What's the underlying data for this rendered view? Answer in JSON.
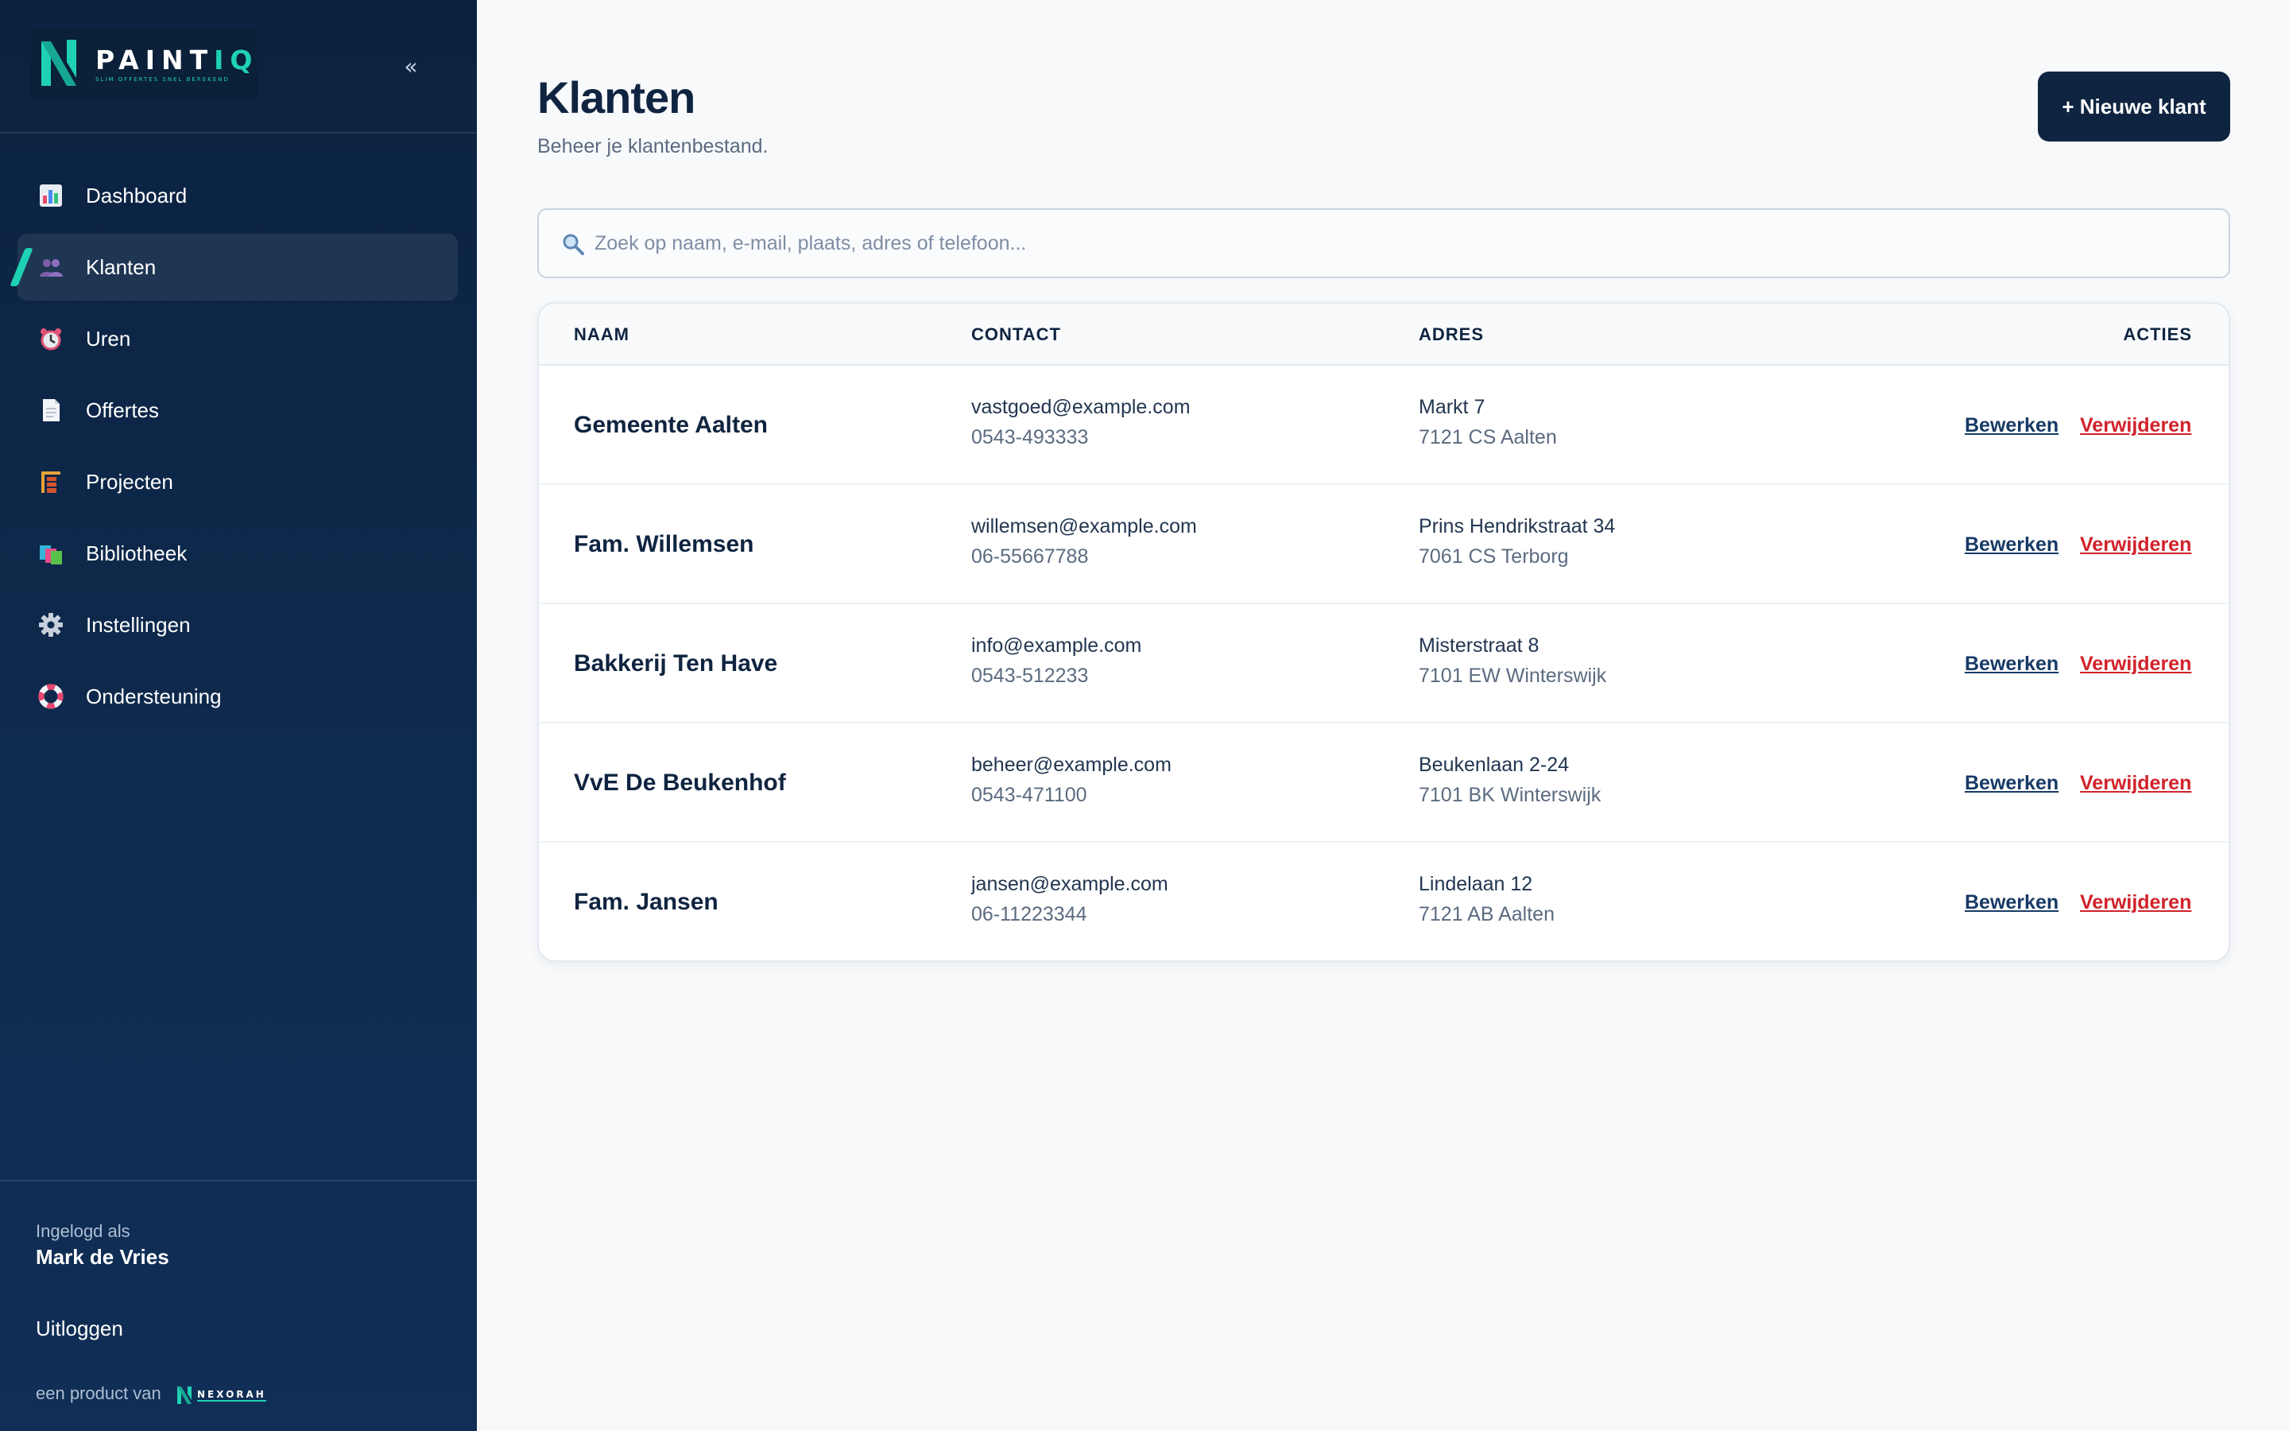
{
  "brand": {
    "name_main": "PAINT",
    "name_accent": "IQ",
    "tagline": "SLIM OFFERTES SNEL BEREKEND",
    "accent_color": "#1fd1b4",
    "sidebar_color": "#0c2240"
  },
  "sidebar": {
    "collapse_icon": "«",
    "items": [
      {
        "label": "Dashboard",
        "icon": "bar-chart-icon"
      },
      {
        "label": "Klanten",
        "icon": "users-icon",
        "active": true
      },
      {
        "label": "Uren",
        "icon": "alarm-clock-icon"
      },
      {
        "label": "Offertes",
        "icon": "document-icon"
      },
      {
        "label": "Projecten",
        "icon": "building-construction-icon"
      },
      {
        "label": "Bibliotheek",
        "icon": "books-icon"
      },
      {
        "label": "Instellingen",
        "icon": "gear-icon"
      },
      {
        "label": "Ondersteuning",
        "icon": "lifebuoy-icon"
      }
    ],
    "logged_in_label": "Ingelogd als",
    "user_name": "Mark de Vries",
    "logout_label": "Uitloggen",
    "product_by": "een product van",
    "company": "NEXORAH"
  },
  "header": {
    "title": "Klanten",
    "subtitle": "Beheer je klantenbestand.",
    "new_button": "+ Nieuwe klant"
  },
  "search": {
    "placeholder": "Zoek op naam, e-mail, plaats, adres of telefoon...",
    "value": ""
  },
  "table": {
    "columns": [
      "NAAM",
      "CONTACT",
      "ADRES",
      "ACTIES"
    ],
    "edit_label": "Bewerken",
    "delete_label": "Verwijderen",
    "rows": [
      {
        "name": "Gemeente Aalten",
        "email": "vastgoed@example.com",
        "phone": "0543-493333",
        "street": "Markt 7",
        "city": "7121 CS Aalten"
      },
      {
        "name": "Fam. Willemsen",
        "email": "willemsen@example.com",
        "phone": "06-55667788",
        "street": "Prins Hendrikstraat 34",
        "city": "7061 CS Terborg"
      },
      {
        "name": "Bakkerij Ten Have",
        "email": "info@example.com",
        "phone": "0543-512233",
        "street": "Misterstraat 8",
        "city": "7101 EW Winterswijk"
      },
      {
        "name": "VvE De Beukenhof",
        "email": "beheer@example.com",
        "phone": "0543-471100",
        "street": "Beukenlaan 2-24",
        "city": "7101 BK Winterswijk"
      },
      {
        "name": "Fam. Jansen",
        "email": "jansen@example.com",
        "phone": "06-11223344",
        "street": "Lindelaan 12",
        "city": "7121 AB Aalten"
      }
    ]
  }
}
